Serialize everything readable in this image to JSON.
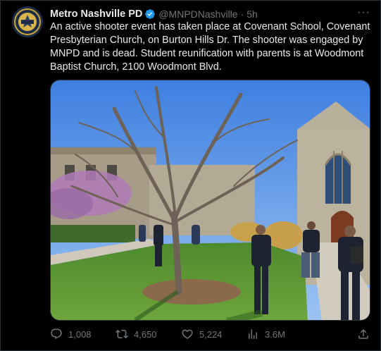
{
  "tweet": {
    "display_name": "Metro Nashville PD",
    "handle": "@MNPDNashville",
    "separator": "·",
    "time": "5h",
    "more": "···",
    "text": "An active shooter event has taken place at Covenant School, Covenant Presbyterian Church, on Burton Hills Dr. The shooter was engaged by MNPD and is dead. Student reunification with parents is at Woodmont Baptist Church, 2100 Woodmont Blvd.",
    "avatar_badge_text": "METRO POLICE",
    "icons": {
      "verified": "verified-badge-icon",
      "reply": "reply-icon",
      "retweet": "retweet-icon",
      "like": "heart-icon",
      "views": "views-chart-icon",
      "share": "share-icon"
    }
  },
  "metrics": {
    "replies": "1,008",
    "retweets": "4,650",
    "likes": "5,224",
    "views": "3.6M"
  },
  "colors": {
    "background": "#000000",
    "text_primary": "#e7e9ea",
    "text_secondary": "#71767b",
    "verified": "#1d9bf0",
    "border": "#2f3336"
  }
}
